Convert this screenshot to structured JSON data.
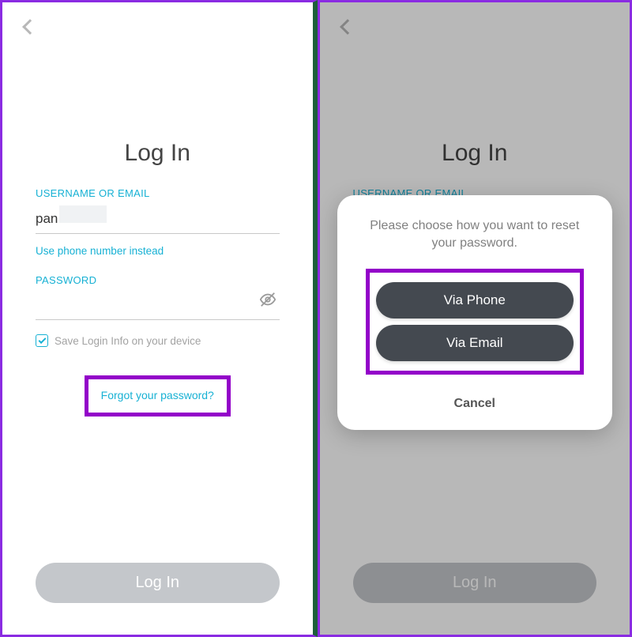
{
  "left": {
    "title": "Log In",
    "username_label": "USERNAME OR EMAIL",
    "username_value": "pan",
    "use_phone": "Use phone number instead",
    "password_label": "PASSWORD",
    "save_login": "Save Login Info on your device",
    "forgot": "Forgot your password?",
    "login_btn": "Log In"
  },
  "right": {
    "title": "Log In",
    "username_label": "USERNAME OR EMAIL",
    "login_btn": "Log In",
    "dialog": {
      "message": "Please choose how you want to reset your password.",
      "via_phone": "Via Phone",
      "via_email": "Via Email",
      "cancel": "Cancel"
    }
  }
}
